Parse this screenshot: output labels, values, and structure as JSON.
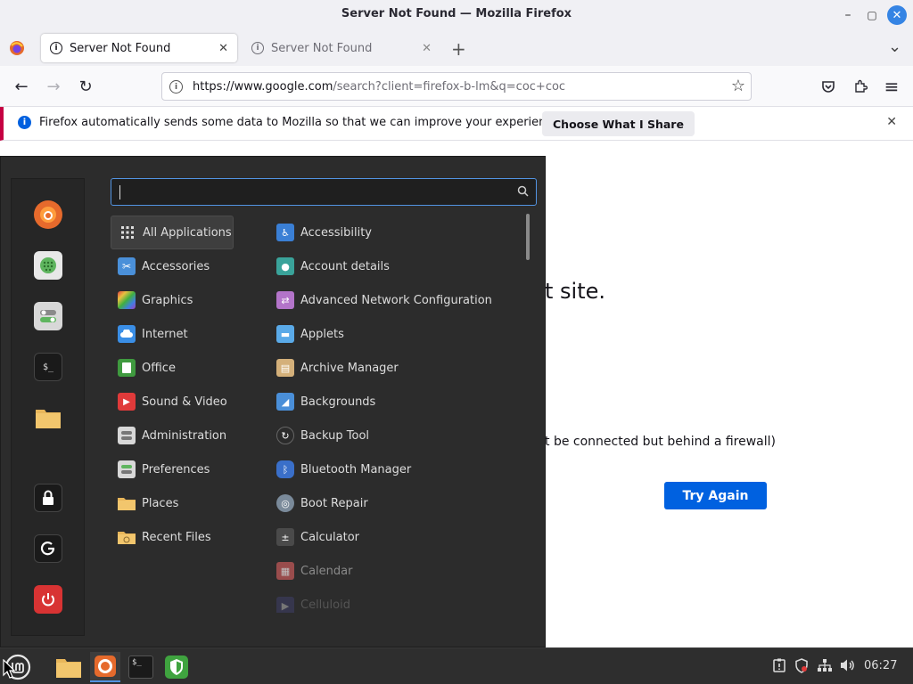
{
  "window": {
    "title": "Server Not Found — Mozilla Firefox",
    "controls": {
      "minimize": "–",
      "maximize": "▢",
      "close": "✕"
    }
  },
  "tabs": [
    {
      "label": "Server Not Found",
      "active": true,
      "close": "✕"
    },
    {
      "label": "Server Not Found",
      "active": false,
      "close": "✕"
    }
  ],
  "tabbar": {
    "new_tab": "+",
    "list_all": "⌄"
  },
  "navbar": {
    "back": "←",
    "forward": "→",
    "reload": "↻",
    "url_host": "https://www.google.com",
    "url_path": "/search?client=firefox-b-lm&q=coc+coc",
    "star": "☆",
    "menu": "≡"
  },
  "notification": {
    "message": "Firefox automatically sends some data to Mozilla so that we can improve your experience.",
    "button": "Choose What I Share",
    "close": "✕"
  },
  "page": {
    "heading_fragment": "t site.",
    "firewall_fragment": "t be connected but behind a firewall)",
    "try_again": "Try Again"
  },
  "menu": {
    "search_value": "",
    "categories": [
      {
        "label": "All Applications",
        "icon": "grid-icon",
        "color": "#3a3a3a"
      },
      {
        "label": "Accessories",
        "icon": "scissors-icon",
        "color": "#4a90d9"
      },
      {
        "label": "Graphics",
        "icon": "palette-icon",
        "color": "#e05050"
      },
      {
        "label": "Internet",
        "icon": "cloud-icon",
        "color": "#3a8ee6"
      },
      {
        "label": "Office",
        "icon": "office-icon",
        "color": "#3f9a3f"
      },
      {
        "label": "Sound & Video",
        "icon": "play-icon",
        "color": "#e03a3a"
      },
      {
        "label": "Administration",
        "icon": "admin-icon",
        "color": "#d8d8d8"
      },
      {
        "label": "Preferences",
        "icon": "prefs-icon",
        "color": "#d8d8d8"
      },
      {
        "label": "Places",
        "icon": "folder-icon",
        "color": "#e8b65a"
      },
      {
        "label": "Recent Files",
        "icon": "recent-folder-icon",
        "color": "#e8b65a"
      }
    ],
    "apps": [
      {
        "label": "Accessibility",
        "icon": "accessibility-icon",
        "color": "#3a7fd5",
        "glyph": "♿"
      },
      {
        "label": "Account details",
        "icon": "account-icon",
        "color": "#3aa39a",
        "glyph": "●"
      },
      {
        "label": "Advanced Network Configuration",
        "icon": "network-config-icon",
        "color": "#b374c9",
        "glyph": "⇄"
      },
      {
        "label": "Applets",
        "icon": "applets-icon",
        "color": "#5aaae8",
        "glyph": "▬"
      },
      {
        "label": "Archive Manager",
        "icon": "archive-icon",
        "color": "#d4b07a",
        "glyph": "▤"
      },
      {
        "label": "Backgrounds",
        "icon": "backgrounds-icon",
        "color": "#4a8fd9",
        "glyph": "◢"
      },
      {
        "label": "Backup Tool",
        "icon": "backup-icon",
        "color": "#2b2b2b",
        "glyph": "↻"
      },
      {
        "label": "Bluetooth Manager",
        "icon": "bluetooth-icon",
        "color": "#3a6fc9",
        "glyph": "ᛒ"
      },
      {
        "label": "Boot Repair",
        "icon": "boot-repair-icon",
        "color": "#7a8a9a",
        "glyph": "◎"
      },
      {
        "label": "Calculator",
        "icon": "calculator-icon",
        "color": "#4a4a4a",
        "glyph": "±"
      },
      {
        "label": "Calendar",
        "icon": "calendar-icon",
        "color": "#c85a5a",
        "glyph": "▦"
      },
      {
        "label": "Celluloid",
        "icon": "celluloid-icon",
        "color": "#4a4a8a",
        "glyph": "▶"
      }
    ],
    "favorites": [
      {
        "name": "firefox-icon",
        "color": "#e66a2c"
      },
      {
        "name": "software-manager-icon",
        "color": "#5fb55f"
      },
      {
        "name": "settings-toggle-icon",
        "color": "#d8d8d8"
      },
      {
        "name": "terminal-icon",
        "color": "#1a1a1a"
      },
      {
        "name": "files-icon",
        "color": "#e8b65a"
      },
      {
        "name": "lock-icon",
        "color": "#1a1a1a"
      },
      {
        "name": "logout-icon",
        "color": "#1a1a1a"
      },
      {
        "name": "power-icon",
        "color": "#d83333"
      }
    ]
  },
  "taskbar": {
    "clock": "06:27"
  }
}
